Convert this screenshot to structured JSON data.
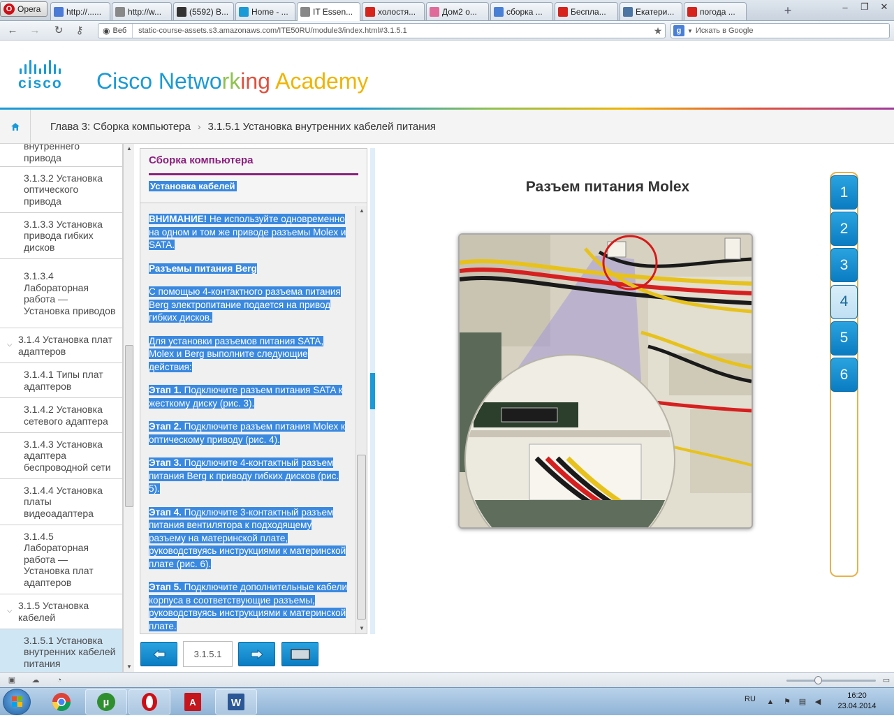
{
  "browser": {
    "app_name": "Opera",
    "tabs": [
      {
        "title": "http://......",
        "favicon": "link-icon",
        "color": "#4b7bd6"
      },
      {
        "title": "http://w...",
        "favicon": "page-icon",
        "color": "#888888"
      },
      {
        "title": "(5592) B...",
        "favicon": "mail-icon",
        "color": "#333333"
      },
      {
        "title": "Home - ...",
        "favicon": "cisco-icon",
        "color": "#1a9ad6"
      },
      {
        "title": "IT Essen...",
        "favicon": "page-icon",
        "color": "#888888"
      },
      {
        "title": "холостя...",
        "favicon": "yandex-icon",
        "color": "#d6241d"
      },
      {
        "title": "Дом2 о...",
        "favicon": "flower-icon",
        "color": "#e06b9a"
      },
      {
        "title": "сборка ...",
        "favicon": "google-icon",
        "color": "#4a7fd6"
      },
      {
        "title": "Беспла...",
        "favicon": "youtube-icon",
        "color": "#d6241d"
      },
      {
        "title": "Екатери...",
        "favicon": "vk-icon",
        "color": "#4c75a3"
      },
      {
        "title": "погода ...",
        "favicon": "yandex-icon",
        "color": "#d6241d"
      }
    ],
    "new_tab_label": "+",
    "address": {
      "web_label": "Веб",
      "url": "static-course-assets.s3.amazonaws.com/ITE50RU/module3/index.html#3.1.5.1"
    },
    "search_placeholder": "Искать в Google"
  },
  "header": {
    "logo_word": "cisco",
    "academy_title_parts": [
      {
        "text": "Cisco ",
        "color": "#1a9ad6"
      },
      {
        "text": "Netwo",
        "color": "#1a9ad6"
      },
      {
        "text": "rk",
        "color": "#8fc24d"
      },
      {
        "text": "ing ",
        "color": "#e0503d"
      },
      {
        "text": "Academy",
        "color": "#f0b400"
      }
    ]
  },
  "breadcrumb": {
    "chapter": "Глава 3: Сборка компьютера",
    "separator": "›",
    "section": "3.1.5.1 Установка внутренних кабелей питания"
  },
  "sidebar": {
    "items": [
      {
        "label": "внутреннего привода",
        "type": "item",
        "active": false,
        "clipped": true
      },
      {
        "label": "3.1.3.2 Установка оптического привода",
        "type": "item",
        "active": false
      },
      {
        "label": "3.1.3.3 Установка привода гибких дисков",
        "type": "item",
        "active": false
      },
      {
        "label": "3.1.3.4 Лабораторная работа — Установка приводов",
        "type": "item",
        "active": false
      },
      {
        "label": "3.1.4 Установка плат адаптеров",
        "type": "group",
        "active": false
      },
      {
        "label": "3.1.4.1 Типы плат адаптеров",
        "type": "item",
        "active": false
      },
      {
        "label": "3.1.4.2 Установка сетевого адаптера",
        "type": "item",
        "active": false
      },
      {
        "label": "3.1.4.3 Установка адаптера беспроводной сети",
        "type": "item",
        "active": false
      },
      {
        "label": "3.1.4.4 Установка платы видеоадаптера",
        "type": "item",
        "active": false
      },
      {
        "label": "3.1.4.5 Лабораторная работа — Установка плат адаптеров",
        "type": "item",
        "active": false
      },
      {
        "label": "3.1.5 Установка кабелей",
        "type": "group",
        "active": false
      },
      {
        "label": "3.1.5.1 Установка внутренних кабелей питания",
        "type": "item",
        "active": true
      }
    ]
  },
  "panel": {
    "title": "Сборка компьютера",
    "subtitle": "Установка кабелей",
    "paragraphs": [
      [
        {
          "b": "ВНИМАНИЕ!"
        },
        {
          "t": " Не используйте одновременно на одном и том же приводе разъемы Molex и SATA."
        }
      ],
      [
        {
          "b": "Разъемы питания Berg"
        }
      ],
      [
        {
          "t": "С помощью 4-контактного разъема питания Berg электропитание подается на привод гибких дисков."
        }
      ],
      [
        {
          "t": "Для установки разъемов питания SATA, Molex и Berg выполните следующие действия:"
        }
      ],
      [
        {
          "b": "Этап 1."
        },
        {
          "t": " Подключите разъем питания SATA к жесткому диску (рис. 3)."
        }
      ],
      [
        {
          "b": "Этап 2."
        },
        {
          "t": " Подключите разъем питания Molex к оптическому приводу (рис. 4)."
        }
      ],
      [
        {
          "b": "Этап 3."
        },
        {
          "t": " Подключите 4-контактный разъем питания Berg к приводу гибких дисков (рис. 5)."
        }
      ],
      [
        {
          "b": "Этап 4."
        },
        {
          "t": " Подключите 3-контактный разъем питания вентилятора к подходящему разъему на материнской плате, руководствуясь инструкциями к материнской плате (рис. 6)."
        }
      ],
      [
        {
          "b": "Этап 5."
        },
        {
          "t": " Подключите дополнительные кабели корпуса в соответствующие разъемы, руководствуясь инструкциями к материнской плате."
        }
      ]
    ],
    "accent_color": "#8b1f7e",
    "highlight_color": "#3a89e0"
  },
  "bottom_nav": {
    "page_number": "3.1.5.1",
    "prev_icon": "arrow-left-icon",
    "next_icon": "arrow-right-icon",
    "fullscreen_icon": "fullscreen-icon"
  },
  "figure": {
    "title": "Разъем питания Molex",
    "image_desc_icon": "molex-connector-photo"
  },
  "steps": {
    "labels": [
      "1",
      "2",
      "3",
      "4",
      "5",
      "6"
    ],
    "selected": "4"
  },
  "taskbar": {
    "apps": [
      "chrome-icon",
      "utorrent-icon",
      "opera-icon",
      "acrobat-icon",
      "word-icon"
    ],
    "language": "RU",
    "time": "16:20",
    "date": "23.04.2014"
  }
}
